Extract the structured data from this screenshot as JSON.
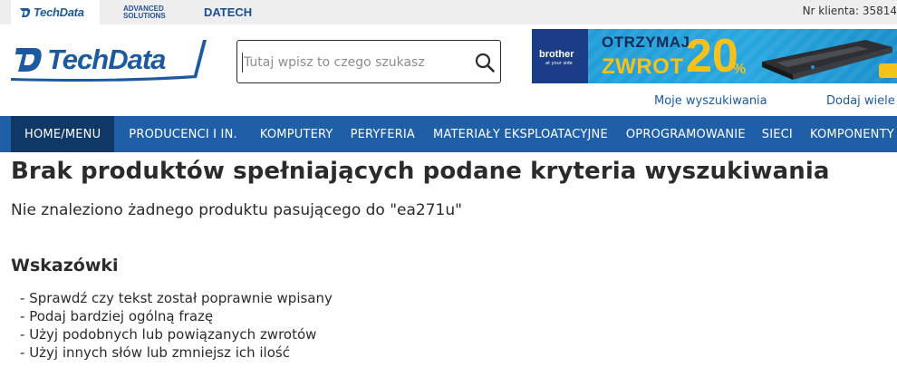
{
  "topbar": {
    "brands": {
      "techdata": "TechData",
      "advanced_line1": "ADVANCED",
      "advanced_line2": "SOLUTIONS",
      "datech": "DATECH"
    },
    "client_number": "Nr klienta: 35814"
  },
  "header": {
    "logo_text": "TechData",
    "search": {
      "value": "",
      "placeholder": "Tutaj wpisz to czego szukasz"
    },
    "banner": {
      "brand": "brother",
      "brand_tagline": "at your side",
      "line1": "OTRZYMAJ",
      "line2": "ZWROT",
      "percent": "20",
      "percent_sign": "%"
    },
    "links": {
      "saved_searches": "Moje wyszukiwania",
      "add_many": "Dodaj wiele"
    }
  },
  "nav": {
    "items": [
      "HOME/MENU",
      "PRODUCENCI I IN.",
      "KOMPUTERY",
      "PERYFERIA",
      "MATERIAŁY EKSPLOATACYJNE",
      "OPROGRAMOWANIE",
      "SIECI",
      "KOMPONENTY"
    ]
  },
  "content": {
    "title": "Brak produktów spełniających podane kryteria wyszukiwania",
    "message": "Nie znaleziono żadnego produktu pasującego do \"ea271u\"",
    "tips_heading": "Wskazówki",
    "tips": [
      "Sprawdź czy tekst został poprawnie wpisany",
      "Podaj bardziej ogólną frazę",
      "Użyj podobnych lub powiązanych zwrotów",
      "Użyj innych słów lub zmniejsz ich ilość"
    ]
  },
  "colors": {
    "nav_background": "#1f5fa8",
    "nav_active": "#0f3867",
    "brand_blue": "#1b5aa0",
    "banner_yellow": "#f4c21b"
  },
  "icons": {
    "search": "magnifier-icon",
    "logo_mark": "techdata-d-icon"
  }
}
